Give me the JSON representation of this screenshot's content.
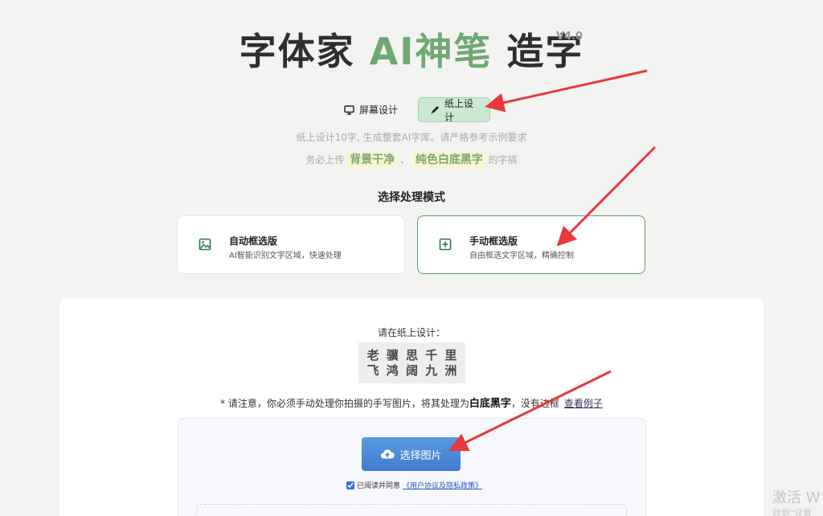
{
  "header": {
    "title_part1": "字体家 ",
    "title_accent": "AI神笔",
    "title_part2": " 造字",
    "version": "V4.0"
  },
  "mode_tabs": {
    "screen_label": "屏幕设计",
    "paper_label": "纸上设计"
  },
  "description": {
    "line1": "纸上设计10字, 生成整套AI字库。请严格参考示例要求",
    "line2_prefix": "务必上传",
    "highlight1": "背景干净",
    "separator": "、",
    "highlight2": "纯色白底黑字",
    "line2_suffix": "的字搞"
  },
  "processing": {
    "section_title": "选择处理模式",
    "auto": {
      "title": "自动框选版",
      "subtitle": "AI智能识别文字区域，快速处理",
      "icon": "image-icon"
    },
    "manual": {
      "title": "手动框选版",
      "subtitle": "自由框选文字区域，精确控制",
      "icon": "plus-square-icon"
    }
  },
  "upload_panel": {
    "prompt": "请在纸上设计：",
    "characters": [
      "老",
      "骥",
      "思",
      "千",
      "里",
      "飞",
      "鸿",
      "阔",
      "九",
      "洲"
    ],
    "notice_prefix": "* 请注意，你必须手动处理你拍摄的手写图片，将其处理为",
    "notice_bold": "白底黑字",
    "notice_suffix": "，没有边框",
    "example_link": "查看例子",
    "upload_button": "选择图片",
    "agree_text": "已阅读并同意",
    "policy_link": "《用户协议及隐私政策》",
    "agree_checked": true
  },
  "watermark": {
    "line1": "激活 W",
    "line2": "转到\"设置"
  },
  "colors": {
    "accent_green": "#6fa873",
    "annotation_arrow": "#e8383b",
    "upload_button": "#4a8ad8"
  }
}
